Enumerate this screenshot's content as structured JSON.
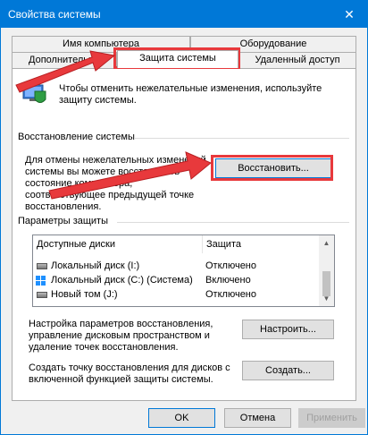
{
  "window": {
    "title": "Свойства системы",
    "close_glyph": "✕"
  },
  "tabs": [
    {
      "label": "Имя компьютера"
    },
    {
      "label": "Оборудование"
    },
    {
      "label": "Дополнительно"
    },
    {
      "label": "Защита системы"
    },
    {
      "label": "Удаленный доступ"
    }
  ],
  "intro": {
    "text": "Чтобы отменить нежелательные изменения, используйте защиту системы."
  },
  "restore": {
    "group_title": "Восстановление системы",
    "text": "Для отмены нежелательных изменений системы вы можете восстановить состояние компьютера, соответствующее предыдущей точке восстановления.",
    "button": "Восстановить..."
  },
  "protection": {
    "group_title": "Параметры защиты",
    "columns": [
      "Доступные диски",
      "Защита"
    ],
    "rows": [
      {
        "name": "Локальный диск (I:)",
        "status": "Отключено",
        "icon": "drive-icon"
      },
      {
        "name": "Локальный диск (C:) (Система)",
        "status": "Включено",
        "icon": "windows-drive-icon"
      },
      {
        "name": "Новый том (J:)",
        "status": "Отключено",
        "icon": "drive-icon"
      }
    ]
  },
  "configure": {
    "text": "Настройка параметров восстановления, управление дисковым пространством и удаление точек восстановления.",
    "button": "Настроить..."
  },
  "create": {
    "text": "Создать точку восстановления для дисков с включенной функцией защиты системы.",
    "button": "Создать..."
  },
  "footer": {
    "ok": "OK",
    "cancel": "Отмена",
    "apply": "Применить"
  },
  "annotation": {
    "color": "#e8393c"
  }
}
